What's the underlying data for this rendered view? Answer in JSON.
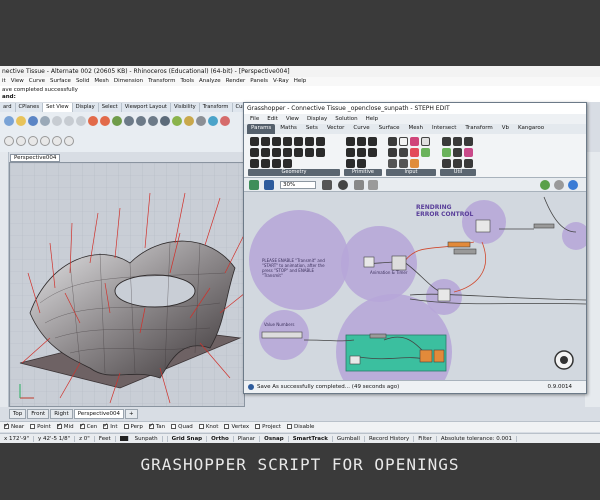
{
  "rhino": {
    "title": "nective Tissue - Alternate 002 (20605 KB) - Rhinoceros (Educational) (64-bit) - [Perspective004]",
    "menu": [
      "it",
      "View",
      "Curve",
      "Surface",
      "Solid",
      "Mesh",
      "Dimension",
      "Transform",
      "Tools",
      "Analyze",
      "Render",
      "Panels",
      "V-Ray",
      "Help"
    ],
    "command_history": "ave completed successfully",
    "command_prompt": "and:",
    "toolbar_tabs": [
      "ard",
      "CPlanes",
      "Set View",
      "Display",
      "Select",
      "Viewport Layout",
      "Visibility",
      "Transform",
      "Curv"
    ],
    "active_toolbar_tab": "Set View",
    "viewport_label": "Perspective004",
    "viewport_tabs": [
      "Top",
      "Front",
      "Right",
      "Perspective004"
    ],
    "active_viewport_tab": "Perspective004",
    "add_tab_symbol": "+",
    "osnaps": [
      {
        "label": "Near",
        "checked": true
      },
      {
        "label": "Point",
        "checked": false
      },
      {
        "label": "Mid",
        "checked": true
      },
      {
        "label": "Cen",
        "checked": true
      },
      {
        "label": "Int",
        "checked": true
      },
      {
        "label": "Perp",
        "checked": false
      },
      {
        "label": "Tan",
        "checked": true
      },
      {
        "label": "Quad",
        "checked": false
      },
      {
        "label": "Knot",
        "checked": false
      },
      {
        "label": "Vertex",
        "checked": false
      },
      {
        "label": "Project",
        "checked": false
      },
      {
        "label": "Disable",
        "checked": false
      }
    ],
    "status": {
      "x": "x 172'-9\"",
      "y": "y 42'-5 1/8\"",
      "z": "z 0\"",
      "units": "Feet",
      "layer": "Sunpath",
      "grid_snap": "Grid Snap",
      "ortho": "Ortho",
      "planar": "Planar",
      "osnap": "Osnap",
      "smarttrack": "SmartTrack",
      "gumball": "Gumball",
      "record_history": "Record History",
      "filter": "Filter",
      "tolerance": "Absolute tolerance: 0.001"
    }
  },
  "grasshopper": {
    "title": "Grasshopper - Connective Tissue _openclose_sunpath - STEPH EDIT",
    "menu": [
      "File",
      "Edit",
      "View",
      "Display",
      "Solution",
      "Help"
    ],
    "tabs": [
      "Params",
      "Maths",
      "Sets",
      "Vector",
      "Curve",
      "Surface",
      "Mesh",
      "Intersect",
      "Transform",
      "Vb",
      "Kangaroo"
    ],
    "active_tab": "Params",
    "panel_labels": [
      "Geometry",
      "Primitive",
      "Input",
      "Util"
    ],
    "zoom": "30%",
    "canvas_notes": {
      "rendering_control": "RENDRING\nERROR CONTROL",
      "enable_note": "PLEASE ENABLE \"Transmit\" and \"START\" to animation, after the press \"STOP\" and ENABLE \"Transmit\"",
      "animation_group": "Animation & Timer",
      "sliders_group": "Value Numbers"
    },
    "status_message": "Save As successfully completed... (49 seconds ago)",
    "version": "0.9.0014"
  },
  "caption": "GRASHOPPER SCRIPT FOR OPENINGS",
  "colors": {
    "background": "#3a3a3a",
    "group_purple": "#b6a6d8",
    "teal_group": "#3bbf9f",
    "wire_red": "#d04a2f"
  }
}
